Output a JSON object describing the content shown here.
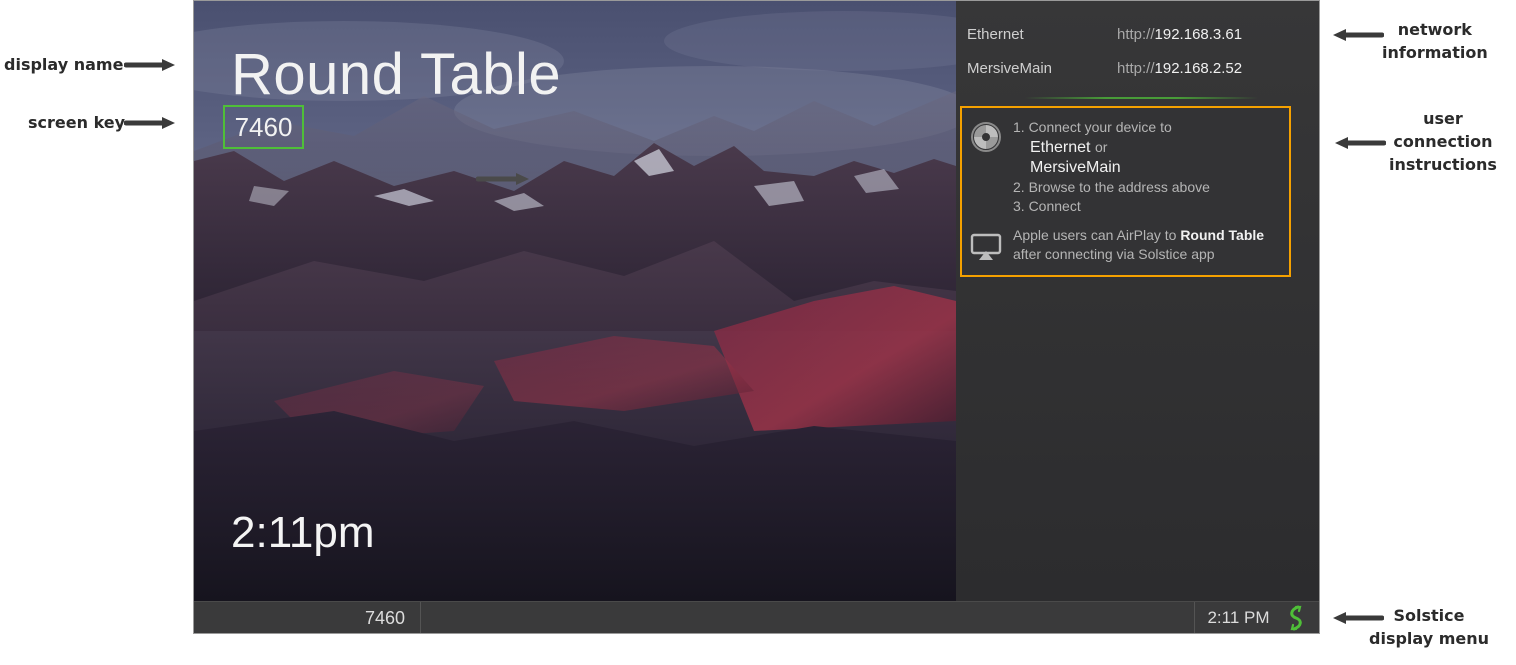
{
  "annotations": {
    "display_name": "display name",
    "screen_key": "screen key",
    "network_information": [
      "network",
      "information"
    ],
    "user_connection_instructions": [
      "user",
      "connection",
      "instructions"
    ],
    "solstice_display_menu": [
      "Solstice",
      "display menu"
    ]
  },
  "screen": {
    "display_name": "Round Table",
    "screen_key": "7460",
    "clock": "2:11pm"
  },
  "network": [
    {
      "name": "Ethernet",
      "protocol": "http://",
      "ip": "192.168.3.61"
    },
    {
      "name": "MersiveMain",
      "protocol": "http://",
      "ip": "192.168.2.52"
    }
  ],
  "instructions": {
    "step1": "1. Connect your device to",
    "network_a": "Ethernet",
    "or": "or",
    "network_b": "MersiveMain",
    "step2": "2. Browse to the address above",
    "step3": "3. Connect",
    "airplay_prefix": "Apple users can AirPlay to",
    "airplay_name": "Round Table",
    "airplay_suffix": "after connecting via Solstice app"
  },
  "taskbar": {
    "screen_key": "7460",
    "time": "2:11 PM"
  },
  "colors": {
    "accent_green": "#4fbf38",
    "instructions_border": "#f5a100",
    "annotation_text": "#2b2b2b"
  },
  "icons": [
    "arrow-left-icon",
    "arrow-right-icon",
    "solstice-logo-icon",
    "airplay-icon",
    "solstice-menu-icon"
  ]
}
